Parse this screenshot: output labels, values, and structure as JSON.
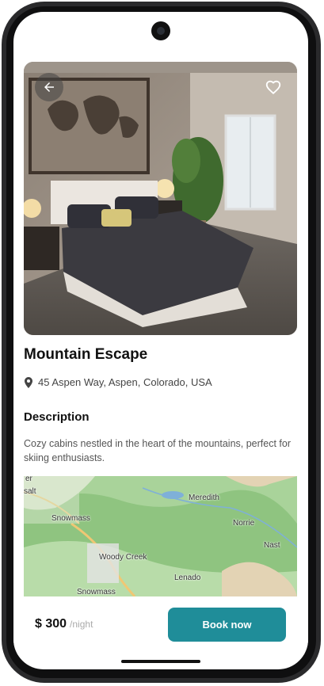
{
  "listing": {
    "title": "Mountain Escape",
    "address": "45 Aspen Way, Aspen, Colorado, USA",
    "description_heading": "Description",
    "description": "Cozy cabins nestled in the heart of the mountains, perfect for skiing enthusiasts."
  },
  "map": {
    "labels": {
      "meredith": "Meredith",
      "norrie": "Norrie",
      "nast": "Nast",
      "snowmass": "Snowmass",
      "woody_creek": "Woody Creek",
      "lenado": "Lenado",
      "snowmass_bottom": "Snowmass",
      "salt": "salt",
      "top_left": "er"
    }
  },
  "booking": {
    "price": "$ 300",
    "unit": "/night",
    "button": "Book now"
  },
  "icons": {
    "back": "arrow-left-icon",
    "favorite": "heart-outline-icon",
    "location": "location-pin-icon"
  },
  "colors": {
    "accent": "#1f8d99"
  }
}
